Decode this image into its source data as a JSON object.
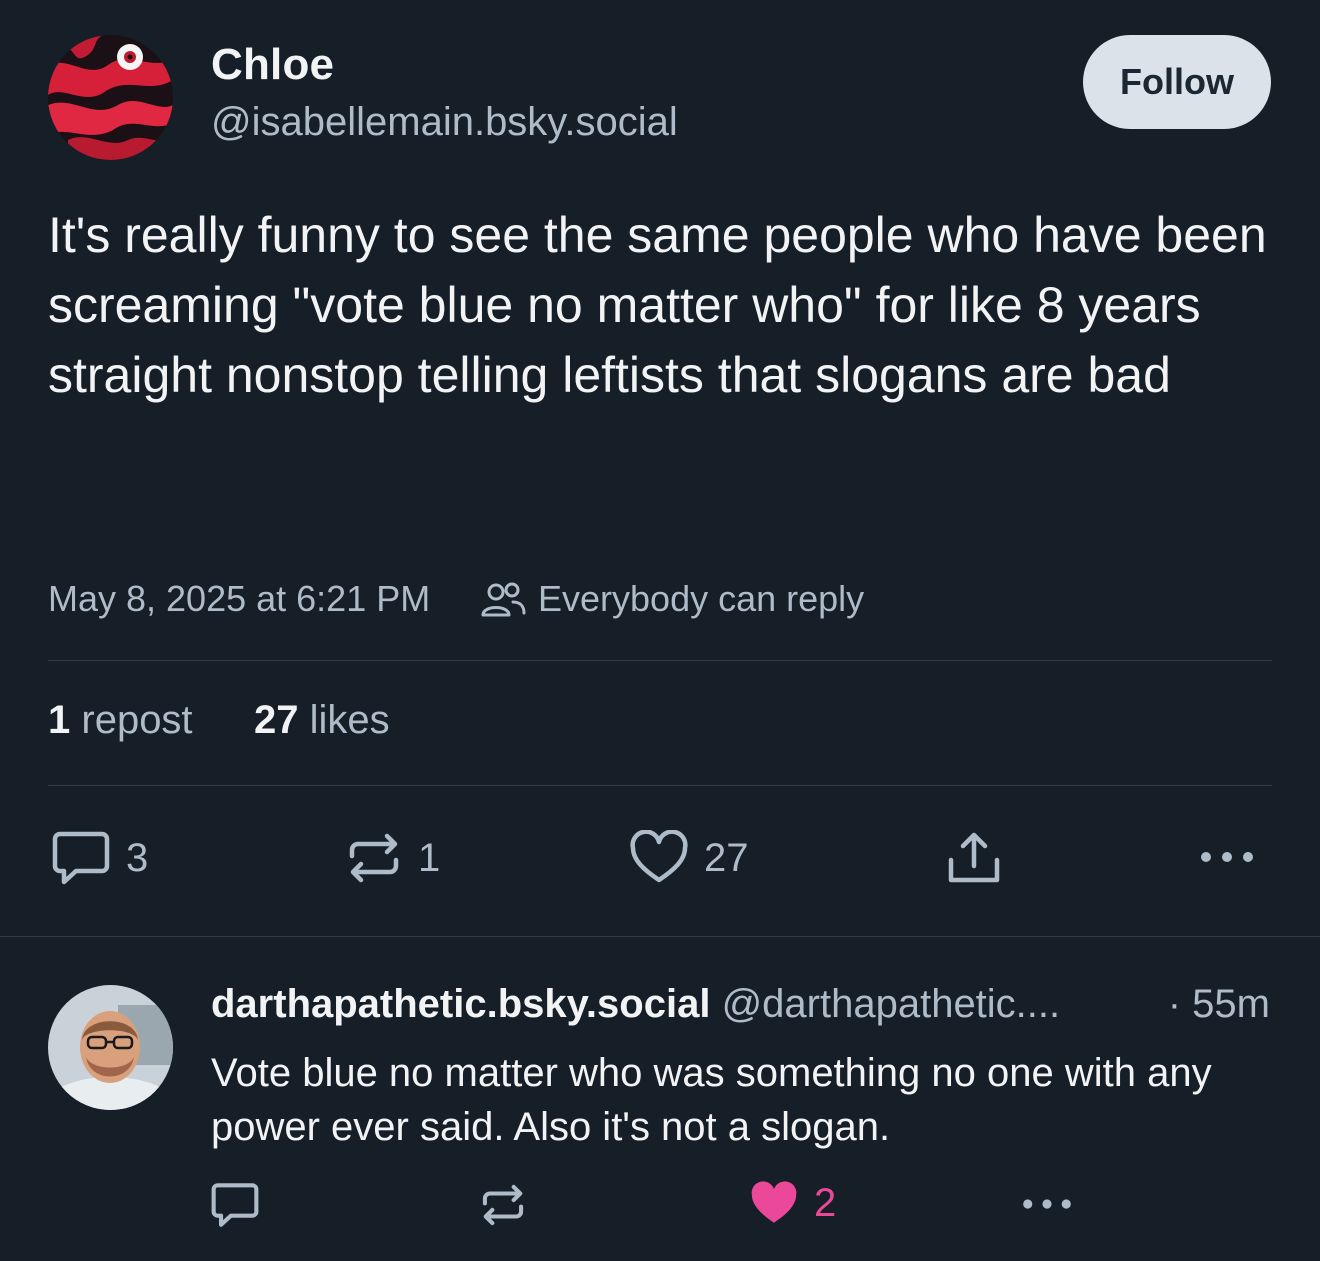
{
  "post": {
    "author_name": "Chloe",
    "author_handle": "@isabellemain.bsky.social",
    "follow_label": "Follow",
    "text": "It's really funny to see the same people who have been screaming \"vote blue no matter who\" for like 8 years straight nonstop telling leftists that slogans are bad",
    "timestamp": "May 8, 2025 at 6:21 PM",
    "reply_setting": "Everybody can reply",
    "repost_count": "1",
    "repost_label": "repost",
    "like_count": "27",
    "like_label": "likes",
    "actions": {
      "reply_count": "3",
      "repost_count": "1",
      "like_count": "27"
    }
  },
  "reply": {
    "author_name": "darthapathetic.bsky.social",
    "author_handle": "@darthapathetic....",
    "time": "· 55m",
    "text": "Vote blue no matter who was something no one with any power ever said. Also it's not a slogan.",
    "like_count": "2"
  },
  "colors": {
    "background": "#161e27",
    "text_primary": "#f1f3f5",
    "text_secondary": "#aebbc9",
    "liked_pink": "#ec4899",
    "follow_button_bg": "#dce2ea"
  },
  "icons": [
    "people-icon",
    "comment-icon",
    "repost-icon",
    "heart-icon",
    "share-icon",
    "more-icon",
    "heart-filled-icon"
  ]
}
